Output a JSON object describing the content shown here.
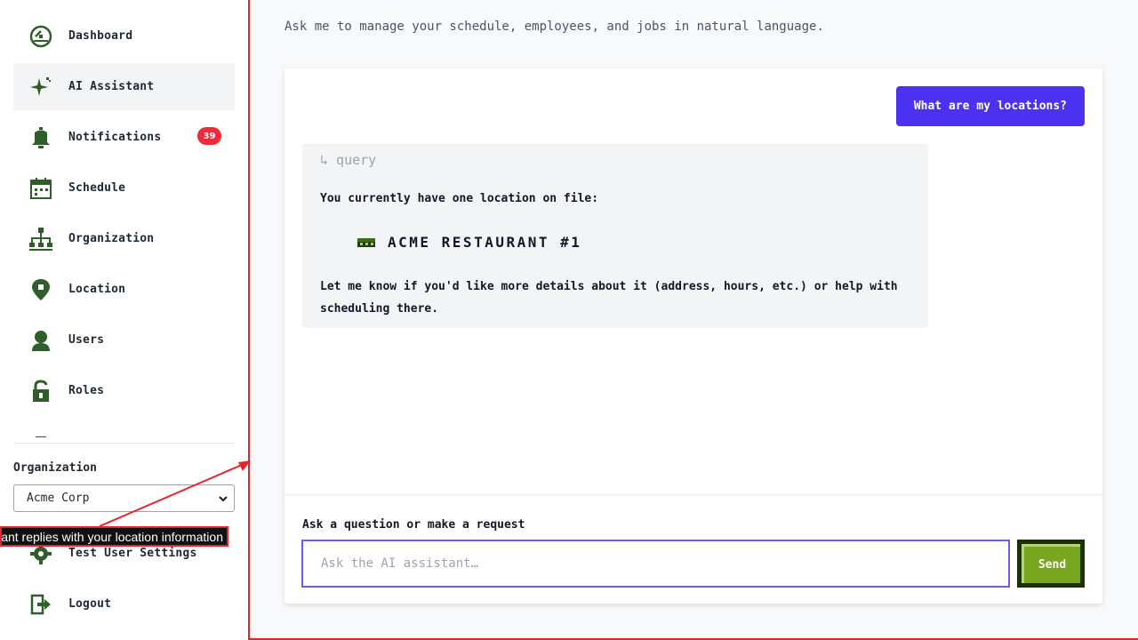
{
  "sidebar": {
    "items": [
      {
        "label": "Dashboard",
        "icon": "dashboard-icon"
      },
      {
        "label": "AI Assistant",
        "icon": "sparkle-icon",
        "active": true
      },
      {
        "label": "Notifications",
        "icon": "bell-icon",
        "badge": "39"
      },
      {
        "label": "Schedule",
        "icon": "calendar-icon"
      },
      {
        "label": "Organization",
        "icon": "org-chart-icon"
      },
      {
        "label": "Location",
        "icon": "location-pin-icon"
      },
      {
        "label": "Users",
        "icon": "user-icon"
      },
      {
        "label": "Roles",
        "icon": "unlock-icon"
      }
    ],
    "org_label": "Organization",
    "org_selected": "Acme Corp",
    "settings_label": "Test User Settings",
    "logout_label": "Logout"
  },
  "main": {
    "intro": "Ask me to manage your schedule, employees, and jobs in natural language.",
    "user_message": "What are my locations?",
    "bot": {
      "tool_tag": "↳ query",
      "line1": "You currently have one location on file:",
      "location_name": "ACME RESTAURANT #1",
      "line2": "Let me know if you'd like more details about it (address, hours, etc.) or help with scheduling there."
    },
    "input_label": "Ask a question or make a request",
    "input_placeholder": "Ask the AI assistant…",
    "send_label": "Send"
  },
  "annotation": {
    "text": "tant replies with your location information"
  },
  "colors": {
    "accent": "#4b32f0",
    "icon_green": "#2f5e2a",
    "send_green": "#7aa51e",
    "badge_red": "#ef2b3a",
    "annotation_red": "#e8232a"
  }
}
